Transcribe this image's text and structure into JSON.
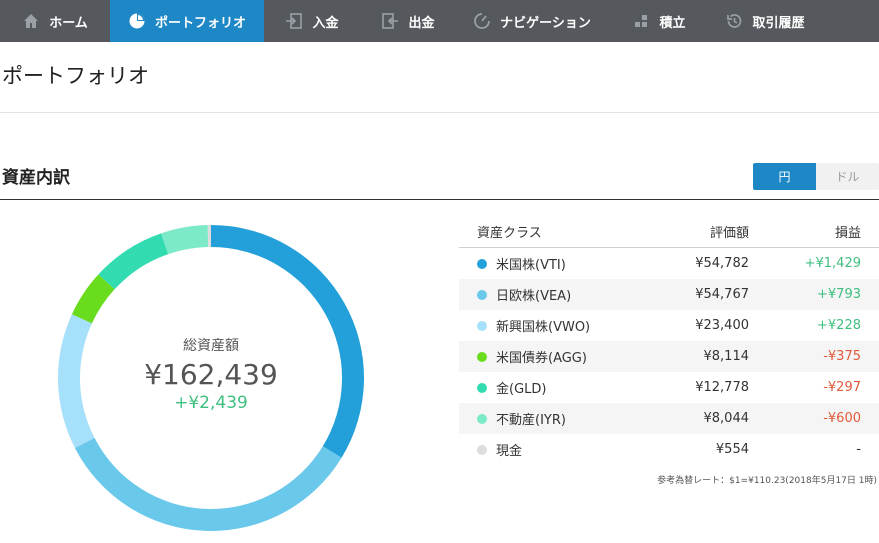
{
  "nav": {
    "items": [
      {
        "label": "ホーム",
        "icon": "home-icon",
        "active": false
      },
      {
        "label": "ポートフォリオ",
        "icon": "pie-chart-icon",
        "active": true
      },
      {
        "label": "入金",
        "icon": "deposit-icon",
        "active": false
      },
      {
        "label": "出金",
        "icon": "withdraw-icon",
        "active": false
      },
      {
        "label": "ナビゲーション",
        "icon": "navigation-icon",
        "active": false
      },
      {
        "label": "積立",
        "icon": "accumulate-icon",
        "active": false
      },
      {
        "label": "取引履歴",
        "icon": "history-icon",
        "active": false
      }
    ]
  },
  "page": {
    "title": "ポートフォリオ"
  },
  "breakdown": {
    "title": "資産内訳",
    "currency": {
      "yen": "円",
      "usd": "ドル",
      "selected": "yen"
    },
    "summary": {
      "label": "総資産額",
      "total": "¥162,439",
      "change": "+¥2,439"
    },
    "table": {
      "headers": {
        "asset_class": "資産クラス",
        "value": "評価額",
        "gain": "損益"
      },
      "rows": [
        {
          "name": "米国株(VTI)",
          "value": "¥54,782",
          "gain": "+¥1,429",
          "color": "#23a0da",
          "amount": 54782,
          "trend": "pos"
        },
        {
          "name": "日欧株(VEA)",
          "value": "¥54,767",
          "gain": "+¥793",
          "color": "#6ac8eb",
          "amount": 54767,
          "trend": "pos"
        },
        {
          "name": "新興国株(VWO)",
          "value": "¥23,400",
          "gain": "+¥228",
          "color": "#a7e0fa",
          "amount": 23400,
          "trend": "pos"
        },
        {
          "name": "米国債券(AGG)",
          "value": "¥8,114",
          "gain": "-¥375",
          "color": "#6adc1e",
          "amount": 8114,
          "trend": "neg"
        },
        {
          "name": "金(GLD)",
          "value": "¥12,778",
          "gain": "-¥297",
          "color": "#32dcb0",
          "amount": 12778,
          "trend": "neg"
        },
        {
          "name": "不動産(IYR)",
          "value": "¥8,044",
          "gain": "-¥600",
          "color": "#7ceac8",
          "amount": 8044,
          "trend": "neg"
        },
        {
          "name": "現金",
          "value": "¥554",
          "gain": "-",
          "color": "#dddddd",
          "amount": 554,
          "trend": "neu"
        }
      ]
    },
    "footnote": "参考為替レート：$1=¥110.23(2018年5月17日 1時)"
  }
}
